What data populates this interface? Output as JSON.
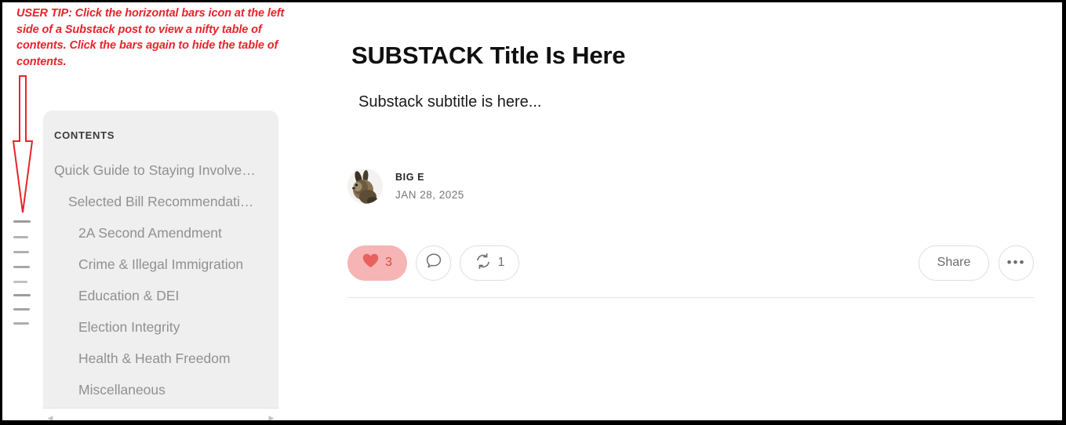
{
  "annotation": {
    "text": "USER TIP: Click the horizontal bars icon at the left side of a Substack post to view a nifty table of contents. Click the bars again to hide the table of contents.",
    "color": "#e8232a",
    "arrow_icon": "down-arrow-icon"
  },
  "toc_toggle": {
    "icon": "horizontal-bars-icon",
    "bar_count": 8,
    "bars": [
      {
        "width": 22,
        "color": "#9c9c9c"
      },
      {
        "width": 19,
        "color": "#b4b4b4"
      },
      {
        "width": 20,
        "color": "#b0b0b0"
      },
      {
        "width": 21,
        "color": "#a8a8a8"
      },
      {
        "width": 18,
        "color": "#c0c0c0"
      },
      {
        "width": 22,
        "color": "#9c9c9c"
      },
      {
        "width": 21,
        "color": "#a4a4a4"
      },
      {
        "width": 20,
        "color": "#aeaeae"
      }
    ]
  },
  "toc_panel": {
    "heading": "CONTENTS",
    "background": "#efefef",
    "items": [
      {
        "label": "Quick Guide to Staying Involve…",
        "level": 0
      },
      {
        "label": "Selected Bill Recommendati…",
        "level": 1
      },
      {
        "label": "2A Second Amendment",
        "level": 2
      },
      {
        "label": "Crime & Illegal Immigration",
        "level": 2
      },
      {
        "label": "Education & DEI",
        "level": 2
      },
      {
        "label": "Election Integrity",
        "level": 2
      },
      {
        "label": "Health & Heath Freedom",
        "level": 2
      },
      {
        "label": "Miscellaneous",
        "level": 2
      }
    ],
    "scrollbar": {
      "left_arrow": "◀",
      "right_arrow": "▶"
    }
  },
  "post": {
    "title": "SUBSTACK Title Is Here",
    "subtitle": "Substack subtitle is here...",
    "author": "BIG E",
    "date": "JAN 28, 2025",
    "avatar_icon": "rabbit-avatar"
  },
  "actions": {
    "like": {
      "icon": "heart-icon",
      "count": "3",
      "background": "#f6b4b4",
      "icon_color": "#e8615c",
      "count_color": "#d9483f"
    },
    "comment": {
      "icon": "comment-bubble-icon",
      "count": ""
    },
    "restack": {
      "icon": "restack-icon",
      "count": "1"
    },
    "share": {
      "label": "Share"
    },
    "more": {
      "icon": "ellipsis-icon",
      "label": "•••"
    }
  }
}
